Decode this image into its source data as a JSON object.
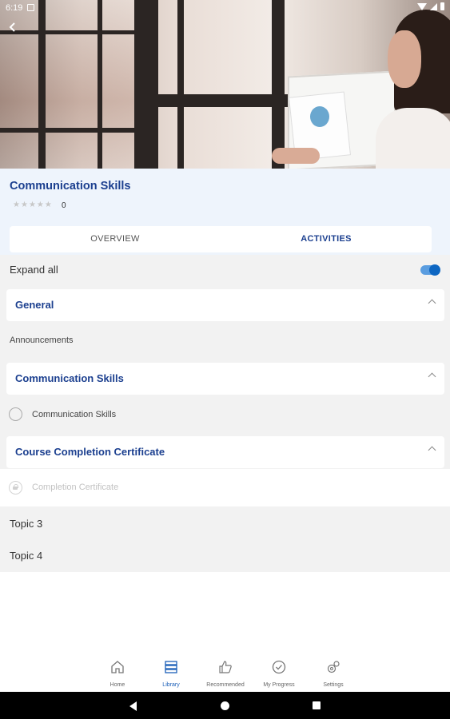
{
  "status_bar": {
    "time": "6:19"
  },
  "course": {
    "title": "Communication Skills",
    "rating_count": "0",
    "stars_total": 5
  },
  "tabs": [
    {
      "label": "OVERVIEW",
      "active": false
    },
    {
      "label": "ACTIVITIES",
      "active": true
    }
  ],
  "expand_all": {
    "label": "Expand all",
    "on": true
  },
  "sections": [
    {
      "title": "General",
      "activity": "Announcements"
    },
    {
      "title": "Communication Skills",
      "activity": "Communication Skills"
    },
    {
      "title": "Course Completion Certificate",
      "activity": "Completion Certificate"
    }
  ],
  "topics": [
    "Topic 3",
    "Topic 4"
  ],
  "bottom_nav": [
    {
      "label": "Home",
      "icon": "home-icon",
      "active": false
    },
    {
      "label": "Library",
      "icon": "library-icon",
      "active": true
    },
    {
      "label": "Recommended",
      "icon": "thumbs-up-icon",
      "active": false
    },
    {
      "label": "My Progress",
      "icon": "check-circle-icon",
      "active": false
    },
    {
      "label": "Settings",
      "icon": "gear-icon",
      "active": false
    }
  ],
  "colors": {
    "brand_blue": "#1b3f8f",
    "toggle_blue": "#0d66c2",
    "header_bg": "#eef4fc",
    "list_bg": "#f2f2f2"
  }
}
